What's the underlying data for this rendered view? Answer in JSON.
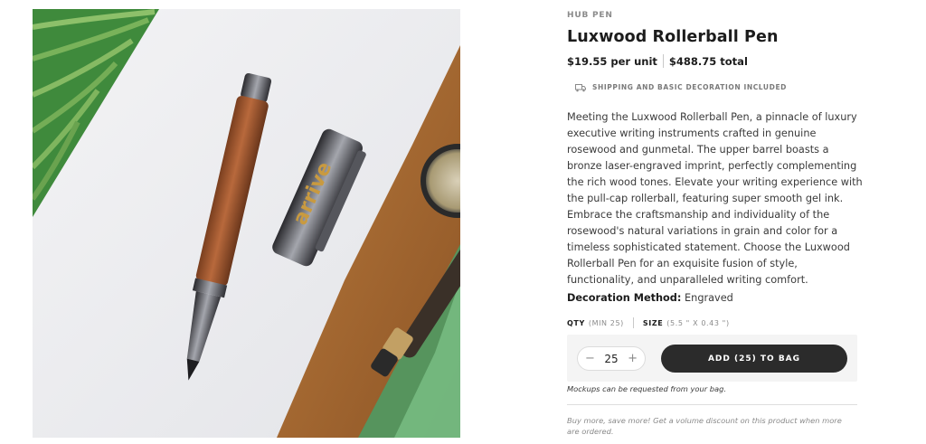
{
  "product": {
    "brand": "HUB PEN",
    "title": "Luxwood Rollerball Pen",
    "price_unit": "$19.55 per unit",
    "price_total": "$488.75 total",
    "shipping_icon": "truck-icon",
    "shipping_text": "SHIPPING AND BASIC DECORATION INCLUDED",
    "description": "Meeting the Luxwood Rollerball Pen, a pinnacle of luxury executive writing instruments crafted in genuine rosewood and gunmetal. The upper barrel boasts a bronze laser-engraved imprint, perfectly complementing the rich wood tones. Elevate your writing experience with the pull-cap rollerball, featuring super smooth gel ink. Embrace the craftsmanship and individuality of the rosewood's natural variations in grain and color for a timeless sophisticated statement. Choose the Luxwood Rollerball Pen for an exquisite fusion of style, functionality, and unparalleled writing comfort.",
    "decoration_label": "Decoration Method:",
    "decoration_value": "Engraved"
  },
  "image": {
    "imprint_text": "arrive"
  },
  "specs": {
    "qty_label": "QTY",
    "qty_min": "(MIN 25)",
    "size_label": "SIZE",
    "size_value": "(5.5 \" X 0.43 \")"
  },
  "cart": {
    "minus_symbol": "−",
    "quantity": "25",
    "plus_symbol": "+",
    "add_label": "ADD (25) TO BAG",
    "mockup_note": "Mockups can be requested from your bag.",
    "volume_note": "Buy more, save more! Get a volume discount on this product when more are ordered."
  },
  "colors": {
    "button_bg": "#2b2b2b",
    "panel_bg": "#f4f4f4",
    "muted_text": "#8a8a8a"
  }
}
